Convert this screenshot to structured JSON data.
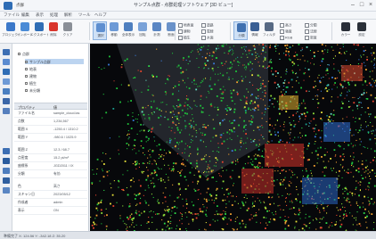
{
  "window": {
    "title": "サンプル点群 - 点群処理ソフトウェア [3D ビュー]",
    "app_label": "点群"
  },
  "menu": [
    "ファイル",
    "編集",
    "表示",
    "処理",
    "解析",
    "ツール",
    "ヘルプ"
  ],
  "ribbon": {
    "buttons": [
      {
        "name": "open",
        "label": "プロジェクト",
        "color": "#3b78c9"
      },
      {
        "name": "import",
        "label": "インポート",
        "color": "#4a8bd6"
      },
      {
        "name": "export",
        "label": "エクスポート",
        "color": "#2f6db5"
      },
      {
        "name": "delete",
        "label": "削除",
        "color": "#d9342b"
      },
      {
        "name": "clear",
        "label": "クリア",
        "color": "#8a8f97"
      },
      {
        "name": "select",
        "label": "選択",
        "color": "#5e8fd0"
      },
      {
        "name": "move",
        "label": "移動",
        "color": "#6d9ad6"
      },
      {
        "name": "fit",
        "label": "全体表示",
        "color": "#4f7fbf"
      },
      {
        "name": "rotate",
        "label": "回転",
        "color": "#7aa2d8"
      },
      {
        "name": "measure",
        "label": "計測",
        "color": "#5a86c3"
      },
      {
        "name": "cross-section",
        "label": "断面",
        "color": "#6a92c9"
      },
      {
        "name": "classify",
        "label": "分類",
        "color": "#3f70b0"
      },
      {
        "name": "info",
        "label": "情報",
        "color": "#3a5f94"
      },
      {
        "name": "filter",
        "label": "フィルタ",
        "color": "#586a84"
      },
      {
        "name": "color",
        "label": "カラー",
        "color": "#2a2f38"
      },
      {
        "name": "settings",
        "label": "設定",
        "color": "#2a2f38"
      }
    ],
    "checks_left": [
      "地表面",
      "建物",
      "植生",
      "道路",
      "電線",
      "水面"
    ],
    "checks_right": [
      "高さ",
      "強度",
      "RGB",
      "分類",
      "法線",
      "密度"
    ]
  },
  "tree": {
    "root": "点群",
    "items": [
      "サンプル点群",
      "地表",
      "建物",
      "植生",
      "未分類"
    ]
  },
  "properties": {
    "header": [
      "プロパティ",
      "値"
    ],
    "rows": [
      {
        "k": "ファイル名",
        "v": "sample_cloud.las"
      },
      {
        "k": "点数",
        "v": "1,234,567"
      },
      {
        "k": "範囲 X",
        "v": "-1250.4 / 1310.2"
      },
      {
        "k": "範囲 Y",
        "v": "-980.6 / 1025.9"
      },
      {
        "k": "範囲 Z",
        "v": "12.3 / 68.7"
      },
      {
        "k": "点密度",
        "v": "15.2 pt/m²"
      },
      {
        "k": "座標系",
        "v": "JGD2011 / IX"
      },
      {
        "k": "分類",
        "v": "有効"
      },
      {
        "k": "色",
        "v": "高さ"
      },
      {
        "k": "スキャン日",
        "v": "2023/05/12"
      },
      {
        "k": "作成者",
        "v": "admin"
      },
      {
        "k": "表示",
        "v": "ON"
      }
    ]
  },
  "status": "準備完了  X: 124.56  Y: -342.18  Z: 35.20"
}
